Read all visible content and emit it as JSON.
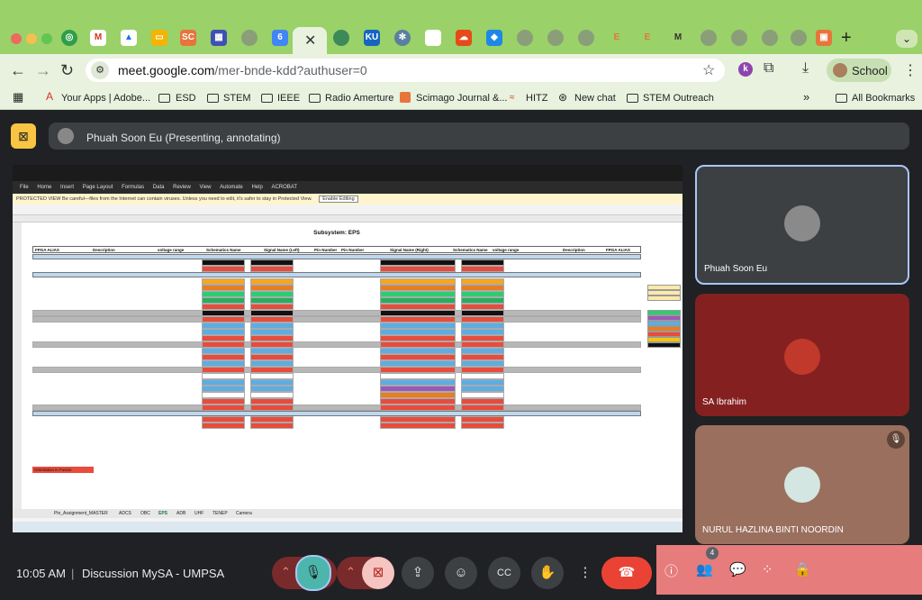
{
  "browser": {
    "url_host": "meet.google.com",
    "url_path": "/mer-bnde-kdd?authuser=0",
    "profile_label": "School",
    "profile_initial": "k",
    "new_tab": "+",
    "tab_close": "✕"
  },
  "bookmarks": [
    {
      "label": "Your Apps | Adobe..."
    },
    {
      "label": "ESD"
    },
    {
      "label": "STEM"
    },
    {
      "label": "IEEE"
    },
    {
      "label": "Radio Amerture"
    },
    {
      "label": "Scimago Journal &..."
    },
    {
      "label": "HITZ"
    },
    {
      "label": "New chat"
    },
    {
      "label": "STEM Outreach"
    },
    {
      "label": "All Bookmarks"
    }
  ],
  "presenting": {
    "text": "Phuah Soon Eu (Presenting, annotating)"
  },
  "spreadsheet": {
    "title": "Subsystem: EPS",
    "menu": [
      "File",
      "Home",
      "Insert",
      "Page Layout",
      "Formulas",
      "Data",
      "Review",
      "View",
      "Automate",
      "Help",
      "ACROBAT"
    ],
    "protected_view": "PROTECTED VIEW  Be careful—files from the Internet can contain viruses. Unless you need to edit, it's safer to stay in Protected View.",
    "enable_editing": "Enable Editing",
    "headers": [
      "FPGA ALIAS",
      "Description",
      "voltage range",
      "Schematics Name",
      "Signal Name (Left)",
      "Pin Number",
      "Pin Number",
      "Signal Name (Right)",
      "Schematics Name",
      "voltage range",
      "Description",
      "FPGA ALIAS"
    ],
    "orientation_label": "Orientation in Fusion",
    "sheet_tabs": [
      "Pin_Assignment_MASTER",
      "ADCS",
      "OBC",
      "EPS",
      "ADB",
      "UHF",
      "TENEP",
      "Camera"
    ]
  },
  "participants": [
    {
      "name": "Phuah Soon Eu"
    },
    {
      "name": "SA Ibrahim"
    },
    {
      "name": "NURUL HAZLINA BINTI NOORDIN"
    }
  ],
  "meeting": {
    "time": "10:05 AM",
    "separator": "|",
    "name": "Discussion MySA - UMPSA",
    "people_count": "4"
  },
  "colors": {
    "tabbar": "#9ad168",
    "toolbar": "#e8f2df",
    "meet_bg": "#202124",
    "end_call": "#ea4335",
    "panel": "#e67c7c"
  }
}
